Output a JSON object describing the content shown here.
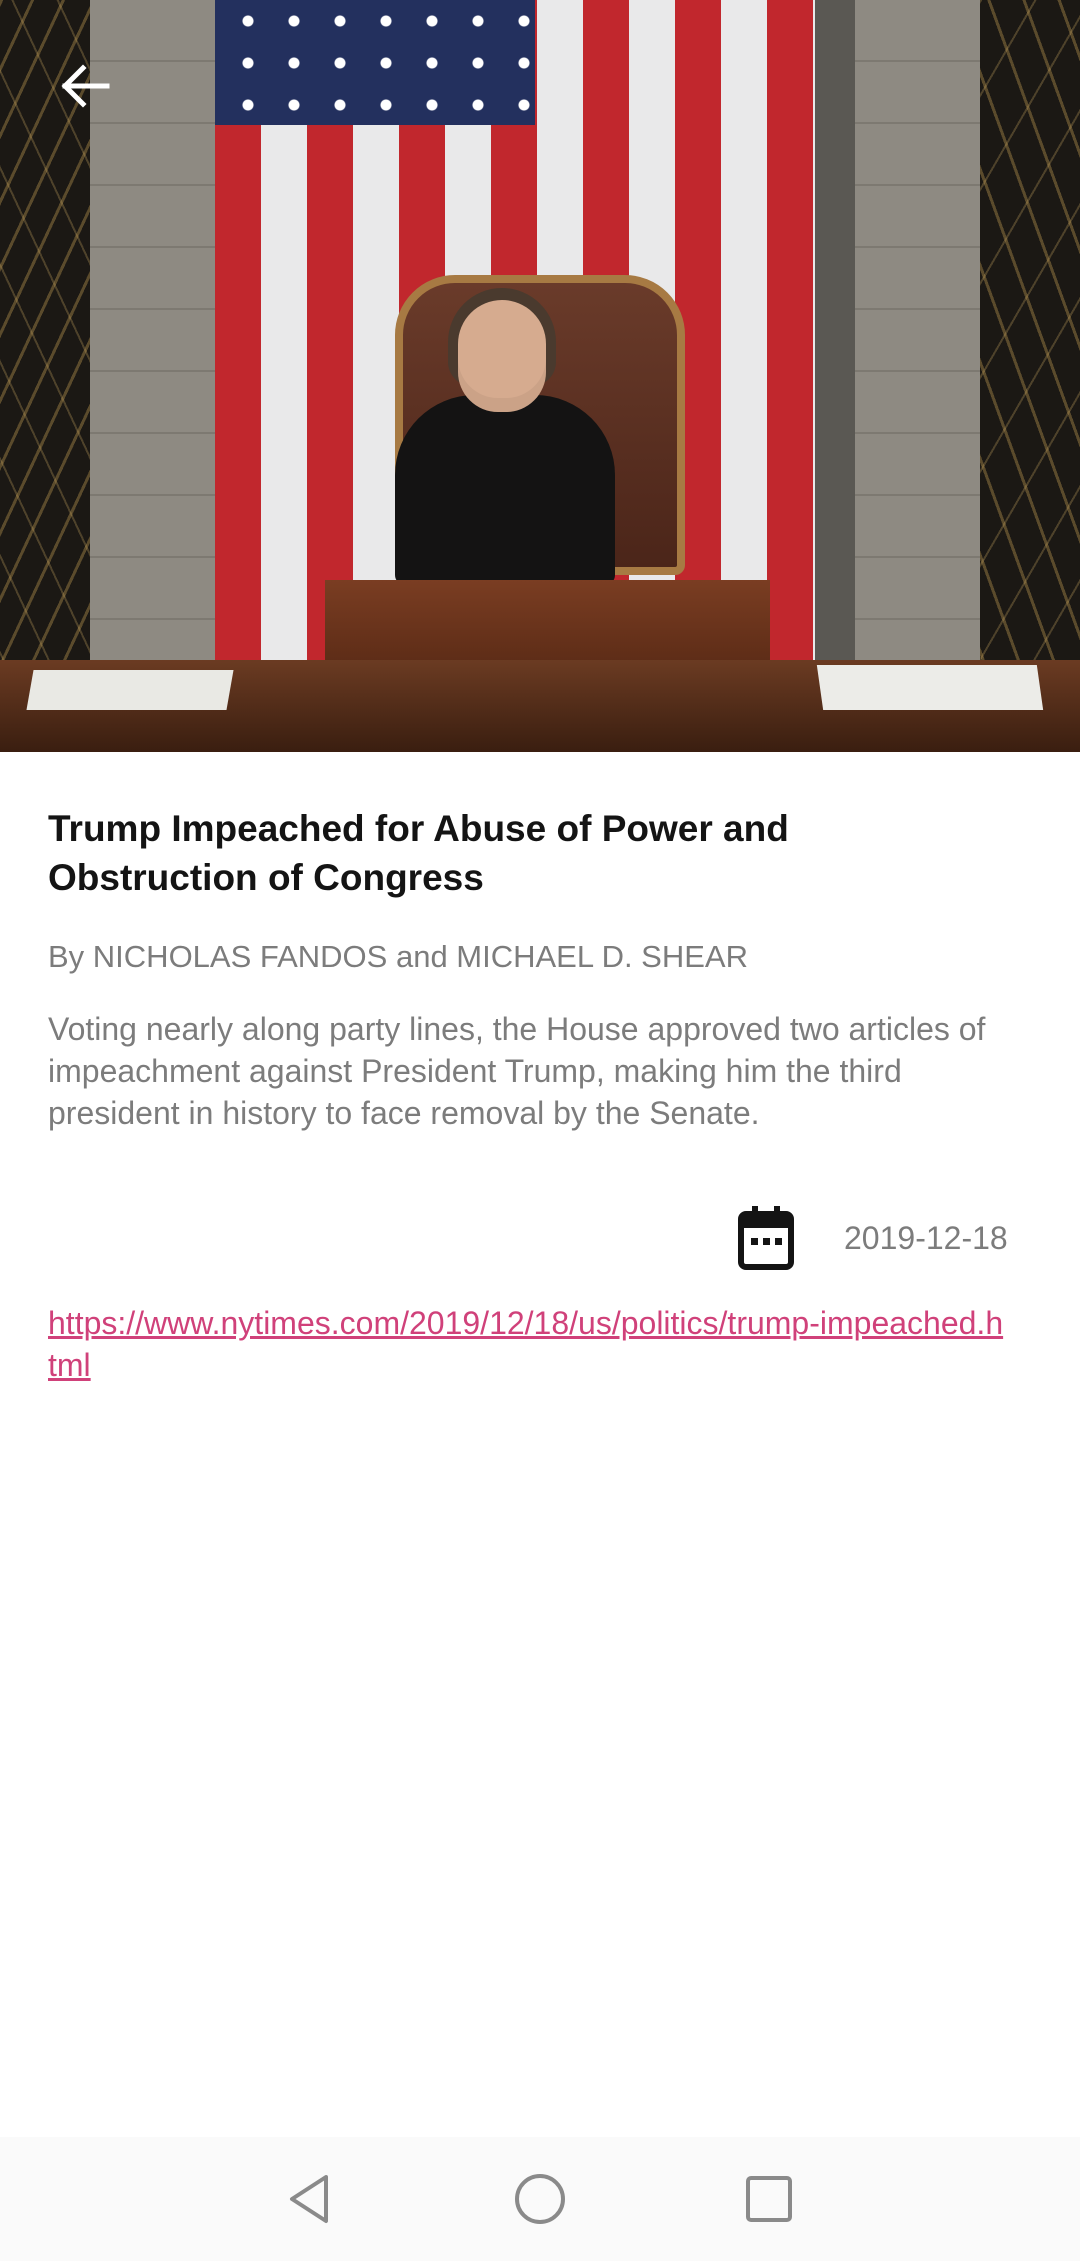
{
  "article": {
    "title": "Trump Impeached for Abuse of Power and Obstruction of Congress",
    "byline": "By NICHOLAS FANDOS and MICHAEL D. SHEAR",
    "summary": "Voting nearly along party lines, the House approved two articles of impeachment against President Trump, making him the third president in history to face removal by the Senate.",
    "date": "2019-12-18",
    "url": "https://www.nytimes.com/2019/12/18/us/politics/trump-impeached.html"
  },
  "icons": {
    "back": "arrow-left-icon",
    "date": "calendar-icon",
    "nav_back": "triangle-back-icon",
    "nav_home": "circle-home-icon",
    "nav_recent": "square-recents-icon"
  },
  "colors": {
    "title": "#141414",
    "secondary_text": "#7c7c7c",
    "link": "#d0417a",
    "navbar_bg": "#fafafa",
    "nav_icon": "#8a8a8a"
  }
}
